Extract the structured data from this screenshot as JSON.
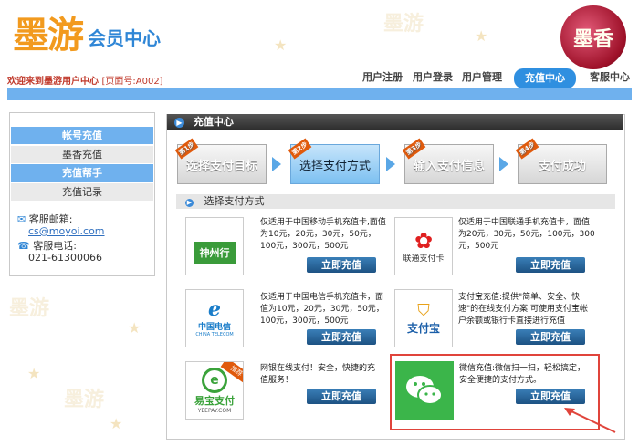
{
  "header": {
    "logo_main": "墨游",
    "logo_sub": "会员中心",
    "seal_text": "墨香",
    "welcome": "欢迎来到墨游用户中心",
    "page_code": "[页面号:A002]"
  },
  "nav": {
    "items": [
      "用户注册",
      "用户登录",
      "用户管理",
      "充值中心",
      "客服中心"
    ],
    "active": "充值中心"
  },
  "sidebar": {
    "items": [
      {
        "label": "帐号充值",
        "style": "blue"
      },
      {
        "label": "墨香充值",
        "style": "gray"
      },
      {
        "label": "充值帮手",
        "style": "blue"
      },
      {
        "label": "充值记录",
        "style": "gray"
      }
    ],
    "email_label": "客服邮箱:",
    "email": "cs@moyoi.com",
    "phone_label": "客服电话:",
    "phone": "021-61300066"
  },
  "panel": {
    "title": "充值中心",
    "steps": [
      {
        "tag": "第1步",
        "label": "选择支付目标"
      },
      {
        "tag": "第2步",
        "label": "选择支付方式"
      },
      {
        "tag": "第3步",
        "label": "输入支付信息"
      },
      {
        "tag": "第4步",
        "label": "支付成功"
      }
    ],
    "current_step": 2,
    "section_title": "选择支付方式",
    "button_label": "立即充值",
    "methods": [
      {
        "logo": "神州行",
        "desc": "仅适用于中国移动手机充值卡,面值为10元，20元，30元，50元，100元，300元，500元"
      },
      {
        "logo": "联通支付卡",
        "desc": "仅适用于中国联通手机充值卡，面值为20元，30元，50元，100元，300元，500元"
      },
      {
        "logo": "中国电信",
        "logo_sub": "CHINA TELECOM",
        "desc": "仅适用于中国电信手机充值卡，面值为10元，20元，30元，50元，100元，300元，500元"
      },
      {
        "logo": "支付宝",
        "desc": "支付宝充值:提供\"简单、安全、快速\"的在线支付方案 可使用支付宝帐户余额或银行卡直接进行充值"
      },
      {
        "logo": "易宝支付",
        "logo_sub": "YEEPAY.COM",
        "badge": "推荐",
        "desc": "网银在线支付！安全，快捷的充值服务！"
      },
      {
        "logo": "",
        "desc": "微信充值:微信扫一扫，轻松搞定，安全便捷的支付方式。"
      }
    ]
  }
}
